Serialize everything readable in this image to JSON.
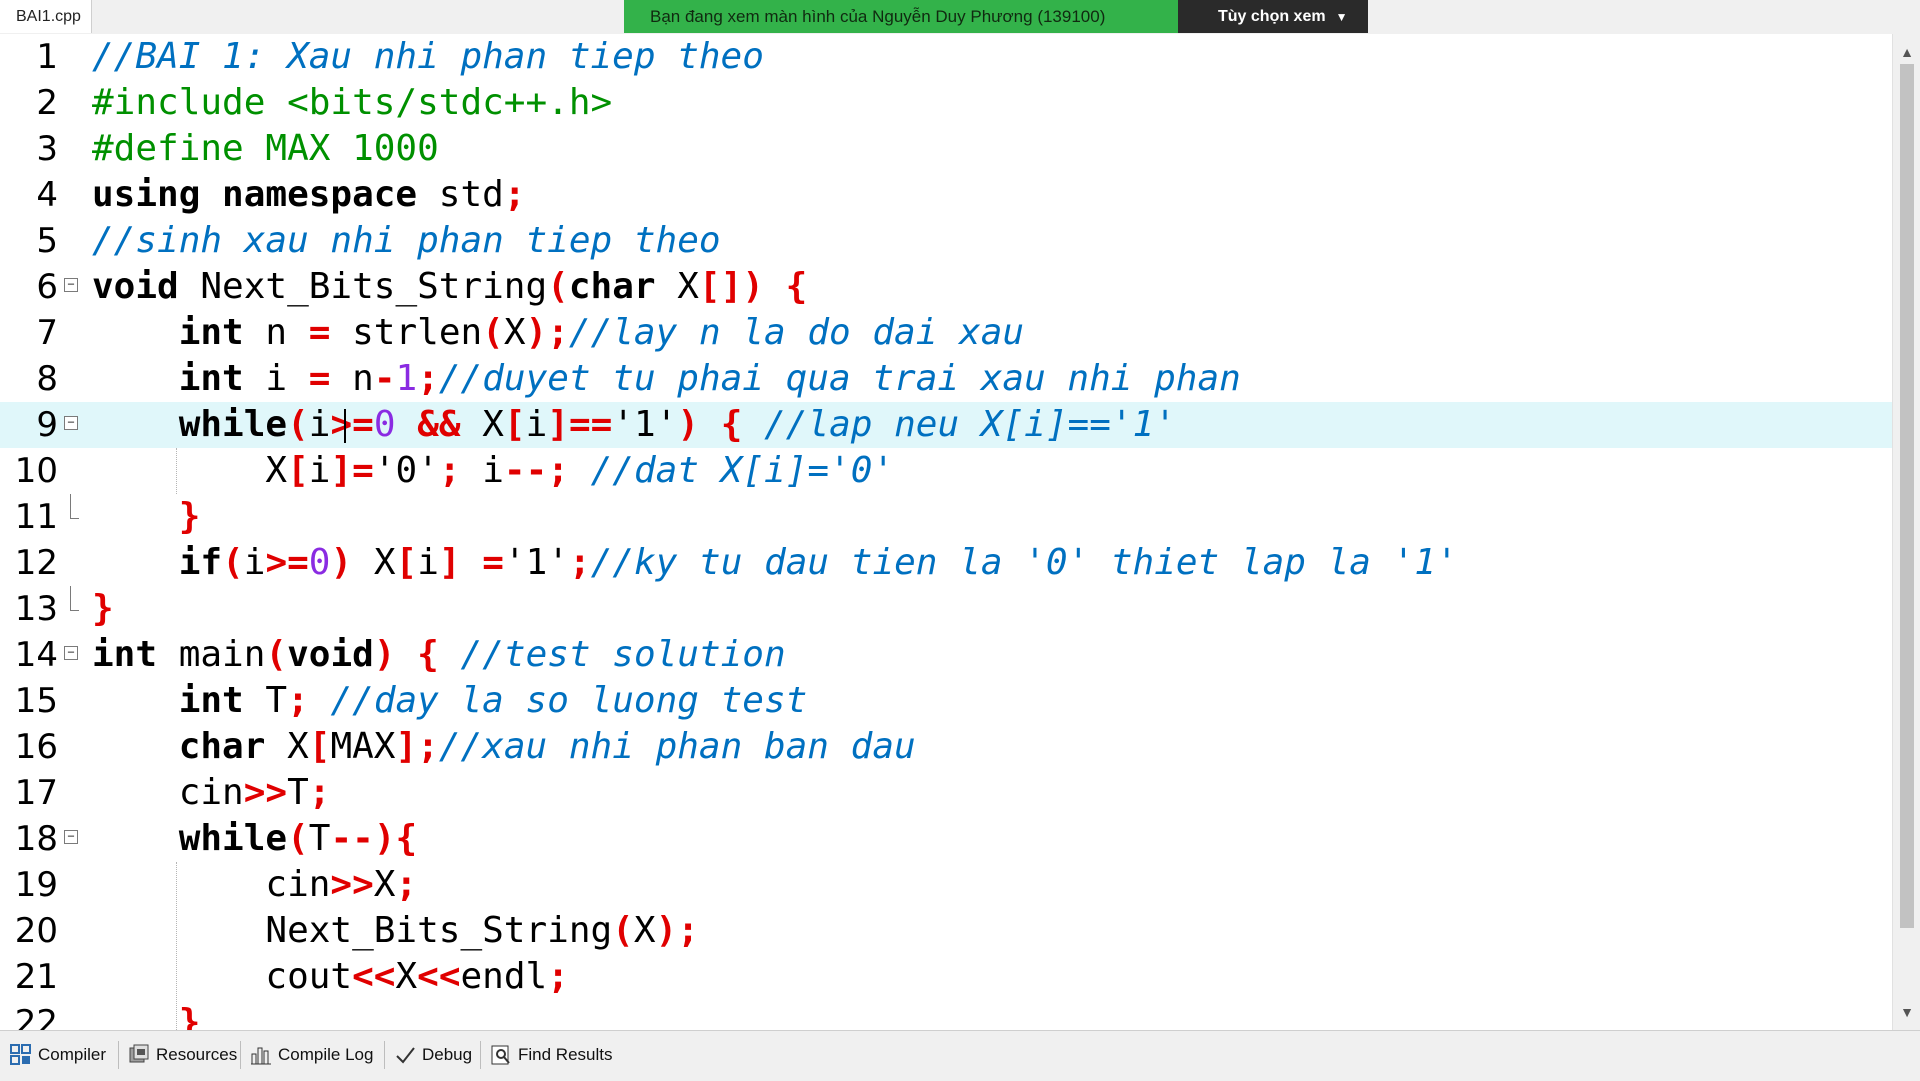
{
  "tab": {
    "filename": "BAI1.cpp"
  },
  "share_banner": {
    "text": "Bạn đang xem màn hình của Nguyễn Duy Phương (139100)",
    "options_label": "Tùy chọn xem"
  },
  "editor": {
    "line_numbers": [
      "1",
      "2",
      "3",
      "4",
      "5",
      "6",
      "7",
      "8",
      "9",
      "10",
      "11",
      "12",
      "13",
      "14",
      "15",
      "16",
      "17",
      "18",
      "19",
      "20",
      "21",
      "22"
    ],
    "active_line": 9
  },
  "bottom_tabs": [
    {
      "label": "Compiler",
      "icon": "compiler-grid-icon"
    },
    {
      "label": "Resources",
      "icon": "resources-icon"
    },
    {
      "label": "Compile Log",
      "icon": "bar-chart-icon"
    },
    {
      "label": "Debug",
      "icon": "checkmark-icon"
    },
    {
      "label": "Find Results",
      "icon": "find-results-icon"
    }
  ],
  "colors": {
    "banner_green": "#33b24a",
    "banner_dark": "#2a2a2a",
    "active_line_bg": "#e0f7fa",
    "comment": "#0070c0",
    "preprocessor": "#009000",
    "operator": "#e00000",
    "number": "#8a2be2"
  }
}
